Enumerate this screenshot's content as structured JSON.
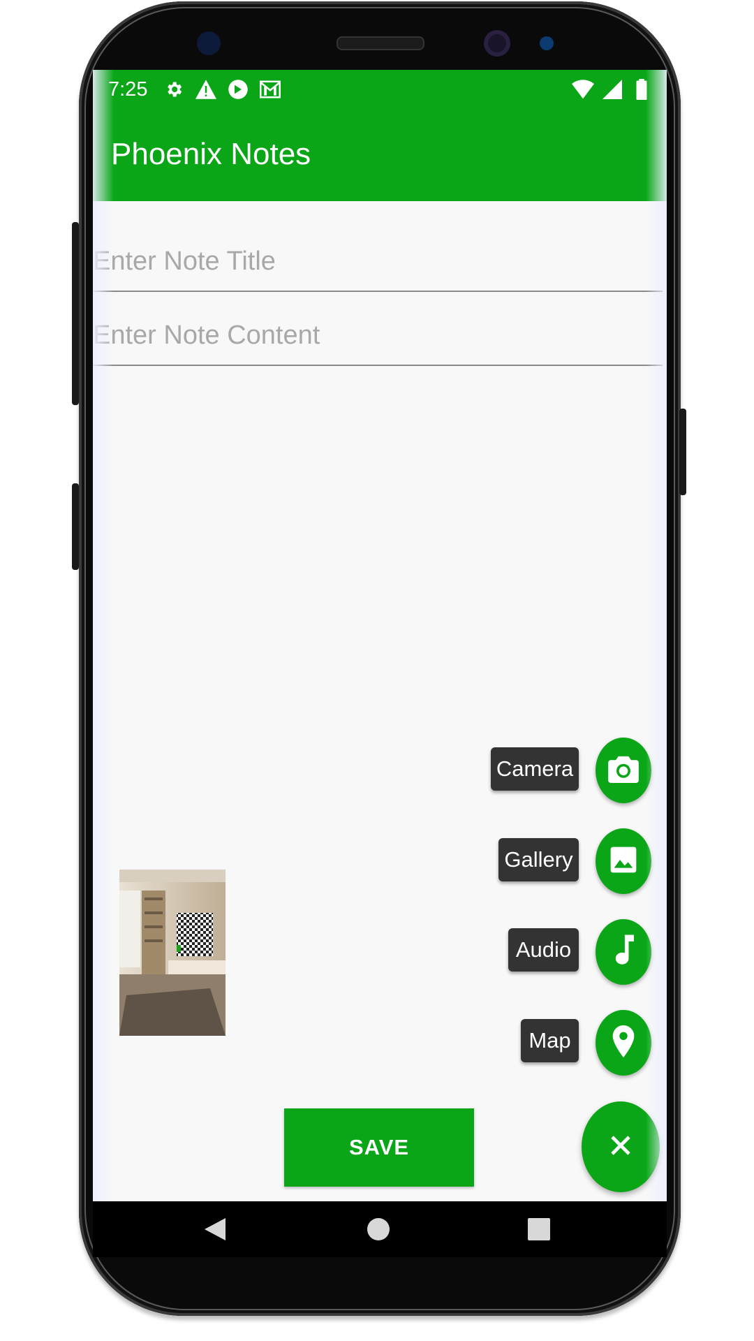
{
  "status_bar": {
    "time": "7:25",
    "left_icons": [
      "gear-icon",
      "warning-icon",
      "sync-icon",
      "gmail-icon"
    ],
    "right_icons": [
      "wifi-icon",
      "cell-signal-icon",
      "battery-icon"
    ]
  },
  "app_bar": {
    "title": "Phoenix Notes"
  },
  "form": {
    "title_placeholder": "Enter Note Title",
    "content_placeholder": "Enter Note Content",
    "save_label": "SAVE"
  },
  "attachments": [
    {
      "type": "image",
      "icon": "room-photo-thumbnail"
    }
  ],
  "fab_menu": {
    "items": [
      {
        "label": "Camera",
        "icon": "camera-icon"
      },
      {
        "label": "Gallery",
        "icon": "image-icon"
      },
      {
        "label": "Audio",
        "icon": "music-note-icon"
      },
      {
        "label": "Map",
        "icon": "map-pin-icon"
      }
    ],
    "main_icon": "close-icon"
  },
  "nav_bar": {
    "icons": [
      "back-icon",
      "home-icon",
      "recents-icon"
    ]
  },
  "colors": {
    "primary": "#0aa617",
    "label_bg": "#333333",
    "screen_bg": "#f8f8f8"
  }
}
